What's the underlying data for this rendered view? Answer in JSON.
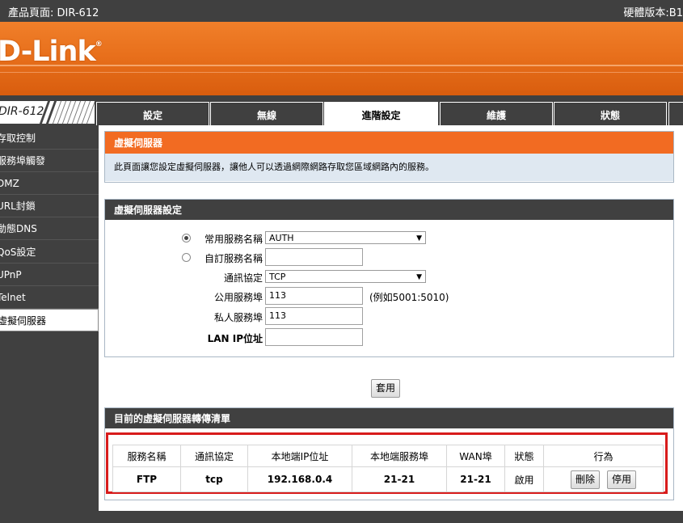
{
  "top_bar": {
    "product_page": "產品頁面: DIR-612",
    "hardware_version": "硬體版本:B1"
  },
  "logo": {
    "text": "D-Link",
    "reg": "®"
  },
  "model": "DIR-612",
  "tabs": [
    {
      "label": "設定"
    },
    {
      "label": "無線"
    },
    {
      "label": "進階設定"
    },
    {
      "label": "維護"
    },
    {
      "label": "狀態"
    }
  ],
  "sidebar": {
    "items": [
      {
        "label": "存取控制"
      },
      {
        "label": "服務埠觸發"
      },
      {
        "label": "DMZ"
      },
      {
        "label": "URL封鎖"
      },
      {
        "label": "動態DNS"
      },
      {
        "label": "QoS設定"
      },
      {
        "label": "UPnP"
      },
      {
        "label": "Telnet"
      },
      {
        "label": "虛擬伺服器"
      }
    ]
  },
  "intro": {
    "title": "虛擬伺服器",
    "description": "此頁面讓您設定虛擬伺服器，讓他人可以透過網際網路存取您區域網路內的服務。"
  },
  "settings": {
    "title": "虛擬伺服器設定",
    "common_service_label": "常用服務名稱",
    "common_service_value": "AUTH",
    "common_service_selected": true,
    "custom_service_label": "自訂服務名稱",
    "custom_service_value": "",
    "protocol_label": "通訊協定",
    "protocol_value": "TCP",
    "public_port_label": "公用服務埠",
    "public_port_value": "113",
    "public_port_hint": "(例如5001:5010)",
    "private_port_label": "私人服務埠",
    "private_port_value": "113",
    "lan_ip_label": "LAN IP位址",
    "lan_ip_value": ""
  },
  "apply_button": "套用",
  "list": {
    "title": "目前的虛擬伺服器轉傳清單",
    "headers": [
      "服務名稱",
      "通訊協定",
      "本地端IP位址",
      "本地端服務埠",
      "WAN埠",
      "狀態",
      "行為"
    ],
    "rows": [
      {
        "service": "FTP",
        "protocol": "tcp",
        "local_ip": "192.168.0.4",
        "local_port": "21-21",
        "wan_port": "21-21",
        "status": "啟用",
        "delete_label": "刪除",
        "disable_label": "停用"
      }
    ]
  },
  "colors": {
    "orange": "#f26b22",
    "dark": "#404040",
    "highlight_red": "#d81c1c"
  }
}
